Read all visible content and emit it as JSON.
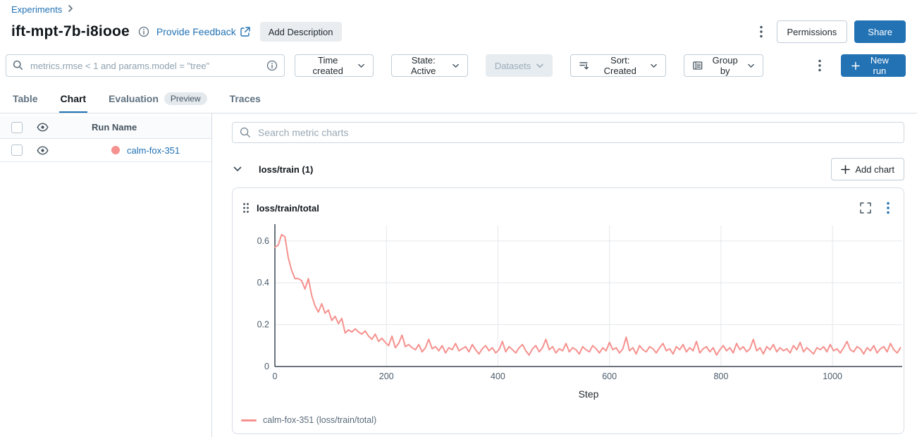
{
  "breadcrumb": {
    "experiments": "Experiments"
  },
  "header": {
    "title": "ift-mpt-7b-i8iooe",
    "provide_feedback": "Provide Feedback",
    "add_description": "Add Description",
    "permissions": "Permissions",
    "share": "Share"
  },
  "toolbar": {
    "search_placeholder": "metrics.rmse < 1 and params.model = \"tree\"",
    "time_created_label": "Time created",
    "state_label": "State: Active",
    "datasets_label": "Datasets",
    "sort_label": "Sort: Created",
    "group_by_label": "Group by",
    "new_run_label": "New run"
  },
  "tabs": [
    {
      "label": "Table",
      "active": false
    },
    {
      "label": "Chart",
      "active": true
    },
    {
      "label": "Evaluation",
      "badge": "Preview",
      "active": false
    },
    {
      "label": "Traces",
      "active": false
    }
  ],
  "run_list": {
    "column_header": "Run Name",
    "runs": [
      {
        "name": "calm-fox-351",
        "color": "#f5918e"
      }
    ]
  },
  "charts_panel": {
    "search_placeholder": "Search metric charts",
    "section_title": "loss/train (1)",
    "add_chart_label": "Add chart",
    "card_title": "loss/train/total"
  },
  "colors": {
    "accent_blue": "#2272b4",
    "line_salmon": "#f5918e",
    "grid": "#e4e7eb",
    "axis": "#3b4752",
    "tick_text": "#4a5b6b"
  },
  "chart_data": {
    "type": "line",
    "title": "loss/train/total",
    "xlabel": "Step",
    "ylabel": "",
    "xlim": [
      0,
      1125
    ],
    "ylim": [
      0,
      0.66
    ],
    "x_ticks": [
      0,
      200,
      400,
      600,
      800,
      1000
    ],
    "y_ticks": [
      0,
      0.2,
      0.4,
      0.6
    ],
    "grid": true,
    "legend_position": "bottom-left",
    "series": [
      {
        "name": "calm-fox-351 (loss/train/total)",
        "color": "#f5918e",
        "x_start": 0,
        "x_interval": 6,
        "values": [
          0.57,
          0.58,
          0.63,
          0.62,
          0.52,
          0.46,
          0.42,
          0.42,
          0.41,
          0.37,
          0.42,
          0.34,
          0.29,
          0.26,
          0.3,
          0.255,
          0.27,
          0.22,
          0.24,
          0.205,
          0.23,
          0.16,
          0.175,
          0.165,
          0.18,
          0.165,
          0.155,
          0.17,
          0.145,
          0.13,
          0.155,
          0.12,
          0.135,
          0.115,
          0.1,
          0.145,
          0.09,
          0.11,
          0.15,
          0.095,
          0.105,
          0.09,
          0.08,
          0.105,
          0.07,
          0.09,
          0.13,
          0.085,
          0.095,
          0.075,
          0.1,
          0.065,
          0.09,
          0.08,
          0.11,
          0.075,
          0.085,
          0.095,
          0.07,
          0.105,
          0.08,
          0.06,
          0.085,
          0.1,
          0.075,
          0.09,
          0.065,
          0.08,
          0.12,
          0.07,
          0.095,
          0.08,
          0.065,
          0.09,
          0.105,
          0.075,
          0.055,
          0.085,
          0.1,
          0.07,
          0.09,
          0.13,
          0.08,
          0.095,
          0.065,
          0.085,
          0.075,
          0.11,
          0.07,
          0.09,
          0.08,
          0.06,
          0.095,
          0.08,
          0.07,
          0.1,
          0.085,
          0.065,
          0.09,
          0.075,
          0.115,
          0.08,
          0.09,
          0.065,
          0.085,
          0.14,
          0.075,
          0.09,
          0.06,
          0.1,
          0.08,
          0.07,
          0.095,
          0.085,
          0.065,
          0.09,
          0.11,
          0.075,
          0.085,
          0.06,
          0.095,
          0.08,
          0.105,
          0.07,
          0.09,
          0.075,
          0.12,
          0.065,
          0.085,
          0.095,
          0.07,
          0.09,
          0.055,
          0.08,
          0.1,
          0.075,
          0.09,
          0.065,
          0.11,
          0.08,
          0.095,
          0.07,
          0.085,
          0.13,
          0.075,
          0.09,
          0.06,
          0.095,
          0.08,
          0.105,
          0.07,
          0.09,
          0.075,
          0.085,
          0.065,
          0.1,
          0.08,
          0.115,
          0.07,
          0.09,
          0.075,
          0.06,
          0.09,
          0.08,
          0.095,
          0.07,
          0.105,
          0.075,
          0.085,
          0.065,
          0.09,
          0.12,
          0.08,
          0.07,
          0.095,
          0.085,
          0.06,
          0.09,
          0.075,
          0.1,
          0.065,
          0.085,
          0.095,
          0.07,
          0.11,
          0.08,
          0.065,
          0.09
        ]
      }
    ]
  }
}
